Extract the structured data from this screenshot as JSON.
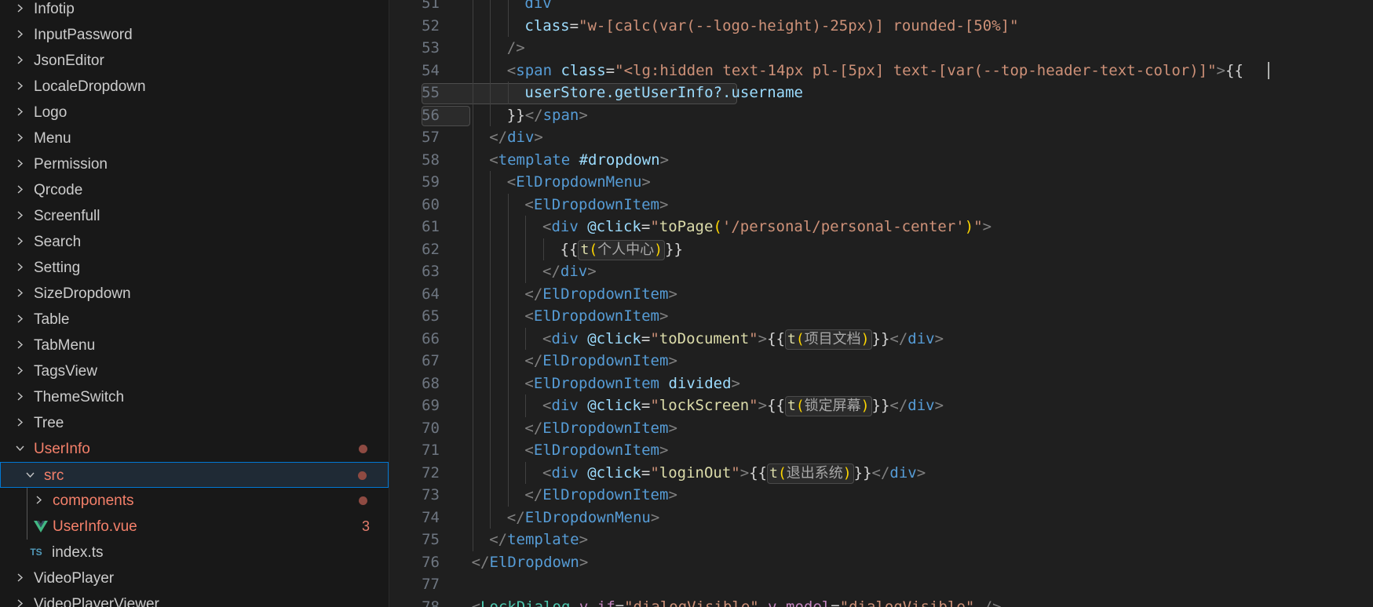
{
  "explorer": {
    "items": [
      {
        "label": "Infotip",
        "depth": 0,
        "kind": "folder",
        "expanded": false
      },
      {
        "label": "InputPassword",
        "depth": 0,
        "kind": "folder",
        "expanded": false
      },
      {
        "label": "JsonEditor",
        "depth": 0,
        "kind": "folder",
        "expanded": false
      },
      {
        "label": "LocaleDropdown",
        "depth": 0,
        "kind": "folder",
        "expanded": false
      },
      {
        "label": "Logo",
        "depth": 0,
        "kind": "folder",
        "expanded": false
      },
      {
        "label": "Menu",
        "depth": 0,
        "kind": "folder",
        "expanded": false
      },
      {
        "label": "Permission",
        "depth": 0,
        "kind": "folder",
        "expanded": false
      },
      {
        "label": "Qrcode",
        "depth": 0,
        "kind": "folder",
        "expanded": false
      },
      {
        "label": "Screenfull",
        "depth": 0,
        "kind": "folder",
        "expanded": false
      },
      {
        "label": "Search",
        "depth": 0,
        "kind": "folder",
        "expanded": false
      },
      {
        "label": "Setting",
        "depth": 0,
        "kind": "folder",
        "expanded": false
      },
      {
        "label": "SizeDropdown",
        "depth": 0,
        "kind": "folder",
        "expanded": false
      },
      {
        "label": "Table",
        "depth": 0,
        "kind": "folder",
        "expanded": false
      },
      {
        "label": "TabMenu",
        "depth": 0,
        "kind": "folder",
        "expanded": false
      },
      {
        "label": "TagsView",
        "depth": 0,
        "kind": "folder",
        "expanded": false
      },
      {
        "label": "ThemeSwitch",
        "depth": 0,
        "kind": "folder",
        "expanded": false
      },
      {
        "label": "Tree",
        "depth": 0,
        "kind": "folder",
        "expanded": false
      },
      {
        "label": "UserInfo",
        "depth": 0,
        "kind": "folder",
        "expanded": true,
        "modified": true,
        "decoration": "dot"
      },
      {
        "label": "src",
        "depth": 1,
        "kind": "folder",
        "expanded": true,
        "modified": true,
        "selected": true,
        "decoration": "dot"
      },
      {
        "label": "components",
        "depth": 2,
        "kind": "folder",
        "expanded": false,
        "modified": true,
        "decoration": "dot"
      },
      {
        "label": "UserInfo.vue",
        "depth": 2,
        "kind": "vue",
        "modified": true,
        "decoration": "count",
        "count": "3"
      },
      {
        "label": "index.ts",
        "depth": 1,
        "kind": "ts",
        "icon_text": "TS"
      },
      {
        "label": "VideoPlayer",
        "depth": 0,
        "kind": "folder",
        "expanded": false
      },
      {
        "label": "VideoPlayerViewer",
        "depth": 0,
        "kind": "folder",
        "expanded": false
      }
    ]
  },
  "editor": {
    "lines": [
      {
        "n": "51",
        "indent": 4,
        "tokens": [
          {
            "t": "div",
            "c": "tag"
          }
        ]
      },
      {
        "n": "52",
        "indent": 4,
        "tokens": [
          {
            "t": "class",
            "c": "attr"
          },
          {
            "t": "=",
            "c": "text"
          },
          {
            "t": "\"w-[calc(var(--logo-height)-25px)] rounded-[50%]\"",
            "c": "str"
          }
        ]
      },
      {
        "n": "53",
        "indent": 3,
        "tokens": [
          {
            "t": "/>",
            "c": "punct"
          }
        ]
      },
      {
        "n": "54",
        "indent": 3,
        "tokens": [
          {
            "t": "<",
            "c": "punct"
          },
          {
            "t": "span",
            "c": "tag"
          },
          {
            "t": " ",
            "c": "text"
          },
          {
            "t": "class",
            "c": "attr"
          },
          {
            "t": "=",
            "c": "text"
          },
          {
            "t": "\"<lg:hidden text-14px pl-[5px] text-[var(--top-header-text-color)]\"",
            "c": "str"
          },
          {
            "t": ">",
            "c": "punct"
          },
          {
            "t": "{{",
            "c": "text"
          }
        ]
      },
      {
        "n": "55",
        "indent": 4,
        "tokens": [
          {
            "t": "userStore.getUserInfo?.username",
            "c": "attr"
          }
        ]
      },
      {
        "n": "56",
        "indent": 3,
        "tokens": [
          {
            "t": "}}",
            "c": "text"
          },
          {
            "t": "</",
            "c": "punct"
          },
          {
            "t": "span",
            "c": "tag"
          },
          {
            "t": ">",
            "c": "punct"
          }
        ]
      },
      {
        "n": "57",
        "indent": 2,
        "tokens": [
          {
            "t": "</",
            "c": "punct"
          },
          {
            "t": "div",
            "c": "tag"
          },
          {
            "t": ">",
            "c": "punct"
          }
        ]
      },
      {
        "n": "58",
        "indent": 2,
        "tokens": [
          {
            "t": "<",
            "c": "punct"
          },
          {
            "t": "template",
            "c": "tag"
          },
          {
            "t": " ",
            "c": "text"
          },
          {
            "t": "#dropdown",
            "c": "attr"
          },
          {
            "t": ">",
            "c": "punct"
          }
        ]
      },
      {
        "n": "59",
        "indent": 3,
        "tokens": [
          {
            "t": "<",
            "c": "punct"
          },
          {
            "t": "ElDropdownMenu",
            "c": "tag"
          },
          {
            "t": ">",
            "c": "punct"
          }
        ]
      },
      {
        "n": "60",
        "indent": 4,
        "tokens": [
          {
            "t": "<",
            "c": "punct"
          },
          {
            "t": "ElDropdownItem",
            "c": "tag"
          },
          {
            "t": ">",
            "c": "punct"
          }
        ]
      },
      {
        "n": "61",
        "indent": 5,
        "tokens": [
          {
            "t": "<",
            "c": "punct"
          },
          {
            "t": "div",
            "c": "tag"
          },
          {
            "t": " ",
            "c": "text"
          },
          {
            "t": "@click",
            "c": "attr"
          },
          {
            "t": "=",
            "c": "text"
          },
          {
            "t": "\"",
            "c": "str"
          },
          {
            "t": "toPage",
            "c": "fn"
          },
          {
            "t": "(",
            "c": "paren"
          },
          {
            "t": "'/personal/personal-center'",
            "c": "str"
          },
          {
            "t": ")",
            "c": "paren"
          },
          {
            "t": "\"",
            "c": "str"
          },
          {
            "t": ">",
            "c": "punct"
          }
        ]
      },
      {
        "n": "62",
        "indent": 6,
        "tokens": [
          {
            "t": "{{",
            "c": "text"
          },
          {
            "t": "t(",
            "c": "hint-open"
          },
          {
            "t": "个人中心",
            "c": "hint"
          },
          {
            "t": ")",
            "c": "hint-close"
          },
          {
            "t": "}}",
            "c": "text"
          }
        ]
      },
      {
        "n": "63",
        "indent": 5,
        "tokens": [
          {
            "t": "</",
            "c": "punct"
          },
          {
            "t": "div",
            "c": "tag"
          },
          {
            "t": ">",
            "c": "punct"
          }
        ]
      },
      {
        "n": "64",
        "indent": 4,
        "tokens": [
          {
            "t": "</",
            "c": "punct"
          },
          {
            "t": "ElDropdownItem",
            "c": "tag"
          },
          {
            "t": ">",
            "c": "punct"
          }
        ]
      },
      {
        "n": "65",
        "indent": 4,
        "tokens": [
          {
            "t": "<",
            "c": "punct"
          },
          {
            "t": "ElDropdownItem",
            "c": "tag"
          },
          {
            "t": ">",
            "c": "punct"
          }
        ]
      },
      {
        "n": "66",
        "indent": 5,
        "tokens": [
          {
            "t": "<",
            "c": "punct"
          },
          {
            "t": "div",
            "c": "tag"
          },
          {
            "t": " ",
            "c": "text"
          },
          {
            "t": "@click",
            "c": "attr"
          },
          {
            "t": "=",
            "c": "text"
          },
          {
            "t": "\"",
            "c": "str"
          },
          {
            "t": "toDocument",
            "c": "fn"
          },
          {
            "t": "\"",
            "c": "str"
          },
          {
            "t": ">",
            "c": "punct"
          },
          {
            "t": "{{",
            "c": "text"
          },
          {
            "t": "t(",
            "c": "hint-open"
          },
          {
            "t": "项目文档",
            "c": "hint"
          },
          {
            "t": ")",
            "c": "hint-close"
          },
          {
            "t": "}}",
            "c": "text"
          },
          {
            "t": "</",
            "c": "punct"
          },
          {
            "t": "div",
            "c": "tag"
          },
          {
            "t": ">",
            "c": "punct"
          }
        ]
      },
      {
        "n": "67",
        "indent": 4,
        "tokens": [
          {
            "t": "</",
            "c": "punct"
          },
          {
            "t": "ElDropdownItem",
            "c": "tag"
          },
          {
            "t": ">",
            "c": "punct"
          }
        ]
      },
      {
        "n": "68",
        "indent": 4,
        "tokens": [
          {
            "t": "<",
            "c": "punct"
          },
          {
            "t": "ElDropdownItem",
            "c": "tag"
          },
          {
            "t": " ",
            "c": "text"
          },
          {
            "t": "divided",
            "c": "attr"
          },
          {
            "t": ">",
            "c": "punct"
          }
        ]
      },
      {
        "n": "69",
        "indent": 5,
        "tokens": [
          {
            "t": "<",
            "c": "punct"
          },
          {
            "t": "div",
            "c": "tag"
          },
          {
            "t": " ",
            "c": "text"
          },
          {
            "t": "@click",
            "c": "attr"
          },
          {
            "t": "=",
            "c": "text"
          },
          {
            "t": "\"",
            "c": "str"
          },
          {
            "t": "lockScreen",
            "c": "fn"
          },
          {
            "t": "\"",
            "c": "str"
          },
          {
            "t": ">",
            "c": "punct"
          },
          {
            "t": "{{",
            "c": "text"
          },
          {
            "t": "t(",
            "c": "hint-open"
          },
          {
            "t": "锁定屏幕",
            "c": "hint"
          },
          {
            "t": ")",
            "c": "hint-close"
          },
          {
            "t": "}}",
            "c": "text"
          },
          {
            "t": "</",
            "c": "punct"
          },
          {
            "t": "div",
            "c": "tag"
          },
          {
            "t": ">",
            "c": "punct"
          }
        ]
      },
      {
        "n": "70",
        "indent": 4,
        "tokens": [
          {
            "t": "</",
            "c": "punct"
          },
          {
            "t": "ElDropdownItem",
            "c": "tag"
          },
          {
            "t": ">",
            "c": "punct"
          }
        ]
      },
      {
        "n": "71",
        "indent": 4,
        "tokens": [
          {
            "t": "<",
            "c": "punct"
          },
          {
            "t": "ElDropdownItem",
            "c": "tag"
          },
          {
            "t": ">",
            "c": "punct"
          }
        ]
      },
      {
        "n": "72",
        "indent": 5,
        "tokens": [
          {
            "t": "<",
            "c": "punct"
          },
          {
            "t": "div",
            "c": "tag"
          },
          {
            "t": " ",
            "c": "text"
          },
          {
            "t": "@click",
            "c": "attr"
          },
          {
            "t": "=",
            "c": "text"
          },
          {
            "t": "\"",
            "c": "str"
          },
          {
            "t": "loginOut",
            "c": "fn"
          },
          {
            "t": "\"",
            "c": "str"
          },
          {
            "t": ">",
            "c": "punct"
          },
          {
            "t": "{{",
            "c": "text"
          },
          {
            "t": "t(",
            "c": "hint-open"
          },
          {
            "t": "退出系统",
            "c": "hint"
          },
          {
            "t": ")",
            "c": "hint-close"
          },
          {
            "t": "}}",
            "c": "text"
          },
          {
            "t": "</",
            "c": "punct"
          },
          {
            "t": "div",
            "c": "tag"
          },
          {
            "t": ">",
            "c": "punct"
          }
        ]
      },
      {
        "n": "73",
        "indent": 4,
        "tokens": [
          {
            "t": "</",
            "c": "punct"
          },
          {
            "t": "ElDropdownItem",
            "c": "tag"
          },
          {
            "t": ">",
            "c": "punct"
          }
        ]
      },
      {
        "n": "74",
        "indent": 3,
        "tokens": [
          {
            "t": "</",
            "c": "punct"
          },
          {
            "t": "ElDropdownMenu",
            "c": "tag"
          },
          {
            "t": ">",
            "c": "punct"
          }
        ]
      },
      {
        "n": "75",
        "indent": 2,
        "tokens": [
          {
            "t": "</",
            "c": "punct"
          },
          {
            "t": "template",
            "c": "tag"
          },
          {
            "t": ">",
            "c": "punct"
          }
        ]
      },
      {
        "n": "76",
        "indent": 1,
        "tokens": [
          {
            "t": "</",
            "c": "punct"
          },
          {
            "t": "ElDropdown",
            "c": "tag"
          },
          {
            "t": ">",
            "c": "punct"
          }
        ]
      },
      {
        "n": "77",
        "indent": 0,
        "tokens": []
      },
      {
        "n": "78",
        "indent": 1,
        "tokens": [
          {
            "t": "<",
            "c": "punct"
          },
          {
            "t": "LockDialog",
            "c": "comp"
          },
          {
            "t": " ",
            "c": "text"
          },
          {
            "t": "v-if",
            "c": "dir"
          },
          {
            "t": "=",
            "c": "text"
          },
          {
            "t": "\"dialogVisible\"",
            "c": "str"
          },
          {
            "t": " ",
            "c": "text"
          },
          {
            "t": "v-model",
            "c": "dir"
          },
          {
            "t": "=",
            "c": "text"
          },
          {
            "t": "\"dialogVisible\"",
            "c": "str"
          },
          {
            "t": " ",
            "c": "text"
          },
          {
            "t": "/>",
            "c": "punct"
          }
        ]
      }
    ]
  },
  "colors": {
    "modified": "#f4806a",
    "vue_icon": "#42b883",
    "ts_icon": "#519aba",
    "selection_border": "#0078d4"
  }
}
